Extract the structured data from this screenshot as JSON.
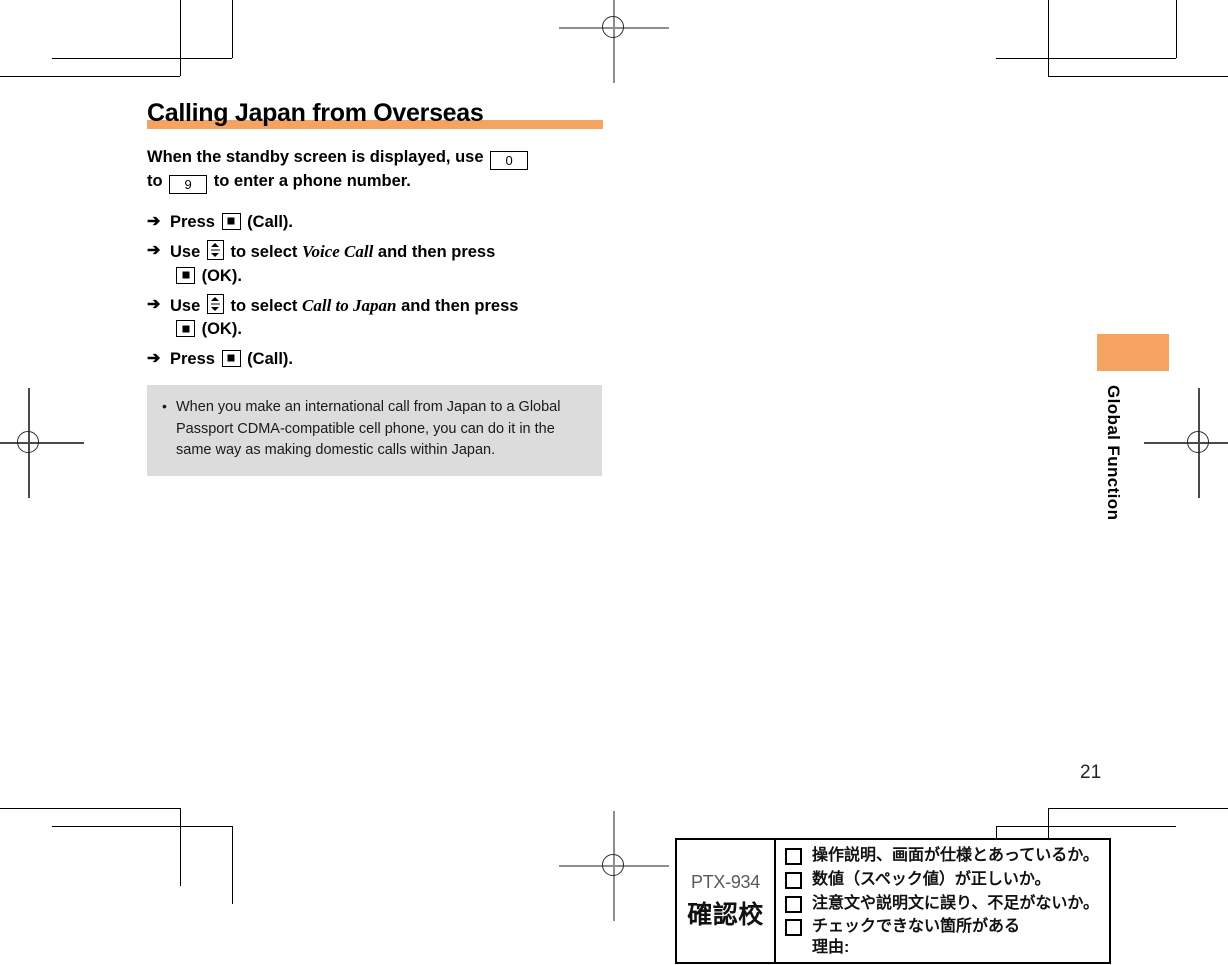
{
  "page": {
    "title": "Calling Japan from Overseas",
    "number": "21",
    "accent_color": "#f5a360",
    "note_bg_color": "#dcdcdc"
  },
  "intro": {
    "part1": "When the standby screen is displayed, use",
    "key1": "0",
    "part2": "to",
    "key2": "9",
    "part3": "to enter a phone number."
  },
  "steps": [
    {
      "arrow": "arrow-right-icon",
      "text_before": "Press",
      "key": "center-key-icon",
      "text_after": "(Call)."
    },
    {
      "arrow": "arrow-right-icon",
      "text_before": "Use",
      "key": "updown-key-icon",
      "text_mid": "to select",
      "term": "Voice Call",
      "text_after": "and then press",
      "key2": "center-key-icon",
      "text_end": "(OK)."
    },
    {
      "arrow": "arrow-right-icon",
      "text_before": "Use",
      "key": "updown-key-icon",
      "text_mid": "to select",
      "term": "Call to Japan",
      "text_after": "and then press",
      "key2": "center-key-icon",
      "text_end": "(OK)."
    },
    {
      "arrow": "arrow-right-icon",
      "text_before": "Press",
      "key": "center-key-icon",
      "text_after": "(Call)."
    }
  ],
  "note": {
    "bullet": "•",
    "text": "When you make an international call from Japan to a Global Passport CDMA-compatible cell phone, you can do it in the same way as making domestic calls within Japan."
  },
  "side_tab": {
    "label": "Global Function"
  },
  "proof_stamp": {
    "code": "PTX-934",
    "stage": "確認校",
    "items": [
      "操作説明、画面が仕様とあっているか。",
      "数値（スペック値）が正しいか。",
      "注意文や説明文に誤り、不足がないか。",
      "チェックできない箇所がある\n理由:"
    ]
  }
}
